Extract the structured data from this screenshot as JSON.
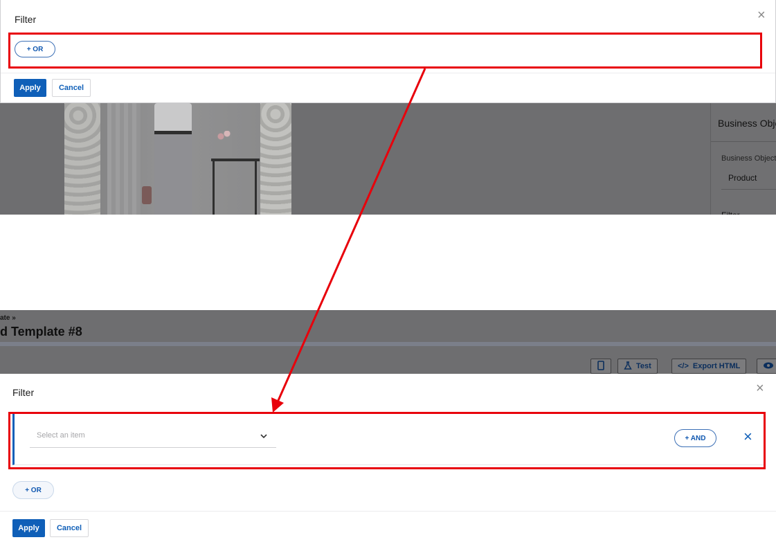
{
  "background": {
    "right_panel": {
      "section_title": "Business Objec",
      "field_label": "Business Object",
      "field_value": "Product",
      "next_section": "Filter"
    },
    "breadcrumb": "ate »",
    "page_heading": "d Template #8",
    "toolbar": {
      "test_label": "Test",
      "export_label": "Export HTML"
    }
  },
  "top_dialog": {
    "title": "Filter",
    "or_button": "+ OR",
    "apply": "Apply",
    "cancel": "Cancel",
    "close": "×"
  },
  "bottom_dialog": {
    "title": "Filter",
    "select_placeholder": "Select an item",
    "and_button": "+ AND",
    "remove": "×",
    "or_button": "+ OR",
    "apply": "Apply",
    "cancel": "Cancel",
    "close": "×"
  },
  "annotation": {
    "color": "#e8000b"
  },
  "colors": {
    "primary": "#0f5fb8",
    "overlay": "#6e6e70"
  }
}
